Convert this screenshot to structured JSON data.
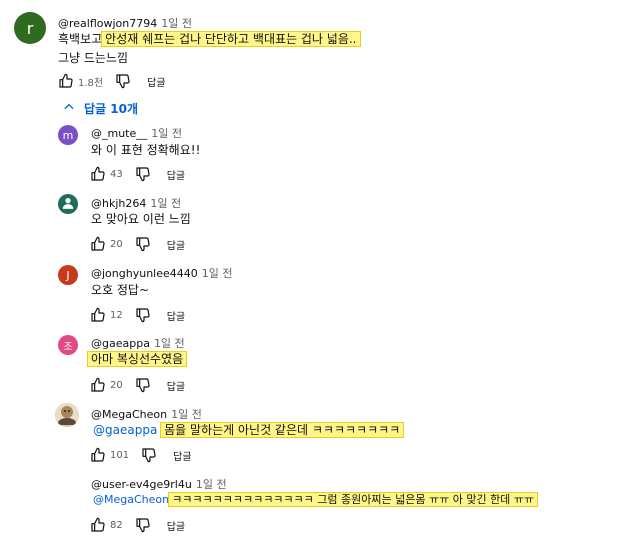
{
  "main_comment": {
    "avatar_letter": "r",
    "avatar_color": "#2e6b1f",
    "handle": "@realflowjon7794",
    "time": "1일 전",
    "text_plain": "흑백보고",
    "text_highlight": "안성재 쉐프는 겁나 단단하고 백대표는 겁나 넓음..",
    "text_line2": "그냥 드는느낌",
    "likes": "1.8천",
    "reply_label": "답글"
  },
  "replies_toggle": {
    "label": "답글 10개"
  },
  "replies": [
    {
      "avatar_letter": "m",
      "avatar_color": "#7b4fc8",
      "handle": "@_mute__",
      "time": "1일 전",
      "text": "와 이 표현 정확해요!!",
      "likes": "43",
      "reply_label": "답글"
    },
    {
      "avatar_letter": "",
      "avatar_color": "#1f6e5b",
      "avatar_icon": "person-icon",
      "handle": "@hkjh264",
      "time": "1일 전",
      "text": "오 맞아요 이런 느낌",
      "likes": "20",
      "reply_label": "답글"
    },
    {
      "avatar_letter": "J",
      "avatar_color": "#c53a1d",
      "handle": "@jonghyunlee4440",
      "time": "1일 전",
      "text": "오호 정답~",
      "likes": "12",
      "reply_label": "답글"
    },
    {
      "avatar_letter": "조",
      "avatar_color": "#e24a86",
      "handle": "@gaeappa",
      "time": "1일 전",
      "text_highlight": "아마 복싱선수였음",
      "likes": "20",
      "reply_label": "답글"
    },
    {
      "avatar_letter": "",
      "avatar_color": "#c9b28e",
      "avatar_icon": "photo-avatar",
      "handle": "@MegaCheon",
      "time": "1일 전",
      "mention": "@gaeappa",
      "text_highlight": "몸을 말하는게 아닌것 같은데 ㅋㅋㅋㅋㅋㅋㅋㅋ",
      "likes": "101",
      "reply_label": "답글"
    },
    {
      "handle": "@user-ev4ge9rl4u",
      "time": "1일 전",
      "mention": "@MegaCheon",
      "text_highlight": "ㅋㅋㅋㅋㅋㅋㅋㅋㅋㅋㅋㅋㅋㅋ 그럼 종원아찌는 넓은몸 ㅠㅠ 아 맞긴 한데 ㅠㅠ",
      "likes": "82",
      "reply_label": "답글"
    }
  ]
}
